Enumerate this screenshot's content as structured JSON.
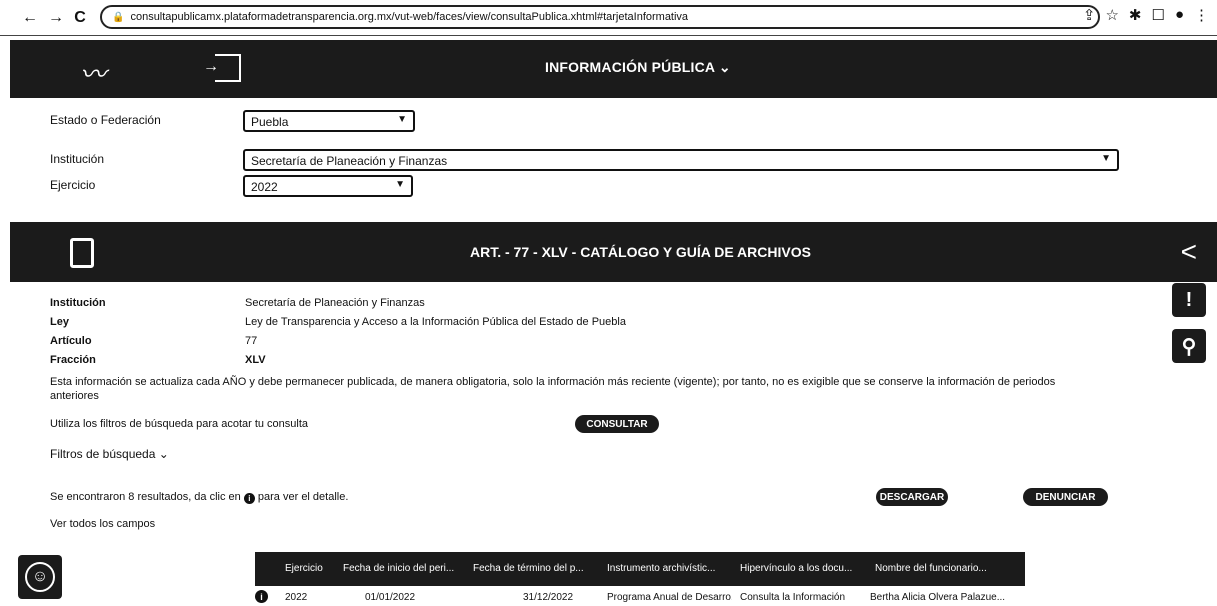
{
  "browser": {
    "url": "consultapublicamx.plataformadetransparencia.org.mx/vut-web/faces/view/consultaPublica.xhtml#tarjetaInformativa",
    "back": "←",
    "forward": "→",
    "reload": "C"
  },
  "header": {
    "title": "INFORMACIÓN PÚBLICA",
    "chevron": "⌄"
  },
  "filters": {
    "estado_label": "Estado o Federación",
    "estado_value": "Puebla",
    "institucion_label": "Institución",
    "institucion_value": "Secretaría de Planeación y Finanzas",
    "ejercicio_label": "Ejercicio",
    "ejercicio_value": "2022"
  },
  "article": {
    "title": "ART. - 77 - XLV - CATÁLOGO Y GUÍA DE ARCHIVOS"
  },
  "details": {
    "institucion_label": "Institución",
    "institucion_value": "Secretaría de Planeación y Finanzas",
    "ley_label": "Ley",
    "ley_value": "Ley de Transparencia y Acceso a la Información Pública del Estado de Puebla",
    "articulo_label": "Artículo",
    "articulo_value": "77",
    "fraccion_label": "Fracción",
    "fraccion_value": "XLV",
    "note": "Esta información se actualiza cada AÑO y debe permanecer publicada, de manera obligatoria, solo la información más reciente (vigente); por tanto, no es exigible que se conserve la información de periodos anteriores"
  },
  "search": {
    "hint": "Utiliza los filtros de búsqueda para acotar tu consulta",
    "consultar": "CONSULTAR",
    "filtros": "Filtros de búsqueda",
    "filtros_chevron": "⌄"
  },
  "results": {
    "found_prefix": "Se encontraron 8 resultados, da clic en",
    "found_suffix": "para ver el detalle.",
    "descargar": "DESCARGAR",
    "denunciar": "DENUNCIAR",
    "ver_todos": "Ver todos los campos"
  },
  "table": {
    "headers": [
      "Ejercicio",
      "Fecha de inicio del peri...",
      "Fecha de término del p...",
      "Instrumento archivístic...",
      "Hipervínculo a los docu...",
      "Nombre del funcionario..."
    ],
    "row": {
      "ejercicio": "2022",
      "inicio": "01/01/2022",
      "termino": "31/12/2022",
      "instrumento": "Programa Anual de Desarro...",
      "hipervinculo": "Consulta la Información",
      "funcionario": "Bertha Alicia Olvera Palazue..."
    }
  }
}
